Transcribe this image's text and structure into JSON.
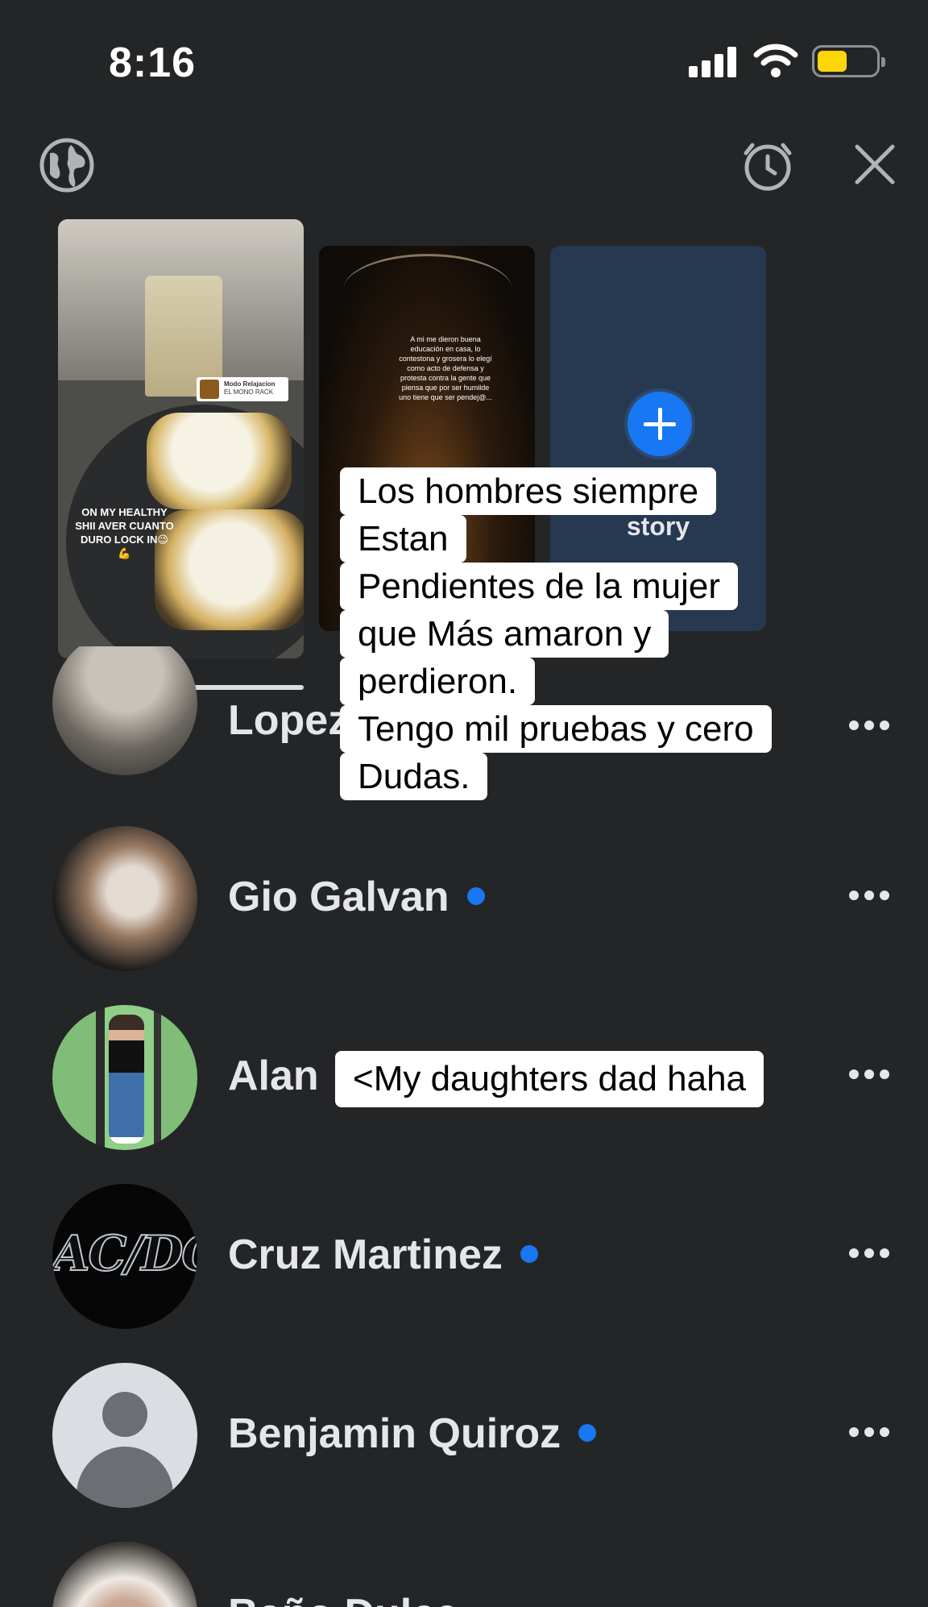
{
  "status_bar": {
    "time": "8:16"
  },
  "stories": {
    "story_1": {
      "badge_title": "Modo Relajacion",
      "badge_subtitle": "EL MONO RACK",
      "caption": "ON MY HEALTHY SHII AVER CUANTO DURO LOCK IN😉💪"
    },
    "story_2": {
      "text": "A mi me dieron buena educación en casa, lo contestona y grosera lo elegí como acto de defensa y protesta contra la gente que piensa que por ser humilde uno tiene que ser pendej@..."
    },
    "story_3": {
      "label": "story"
    }
  },
  "overlay_text": {
    "lines": [
      "Los hombres siempre",
      "Estan",
      "Pendientes de la mujer",
      "que Más amaron y",
      "perdieron.",
      "Tengo mil pruebas y cero",
      "Dudas."
    ],
    "comment": "<My daughters dad haha"
  },
  "contacts": [
    {
      "name": "Lopez",
      "online": false
    },
    {
      "name": "Gio Galvan",
      "online": true
    },
    {
      "name": "Alan",
      "online": false
    },
    {
      "name": "Cruz Martinez",
      "online": true,
      "avatar_text": "AC/DC"
    },
    {
      "name": "Benjamin Quiroz",
      "online": true
    },
    {
      "name": "Baño Dulce",
      "online": false
    }
  ],
  "colors": {
    "background": "#242526",
    "accent": "#1877f2",
    "battery": "#ffd60a"
  }
}
